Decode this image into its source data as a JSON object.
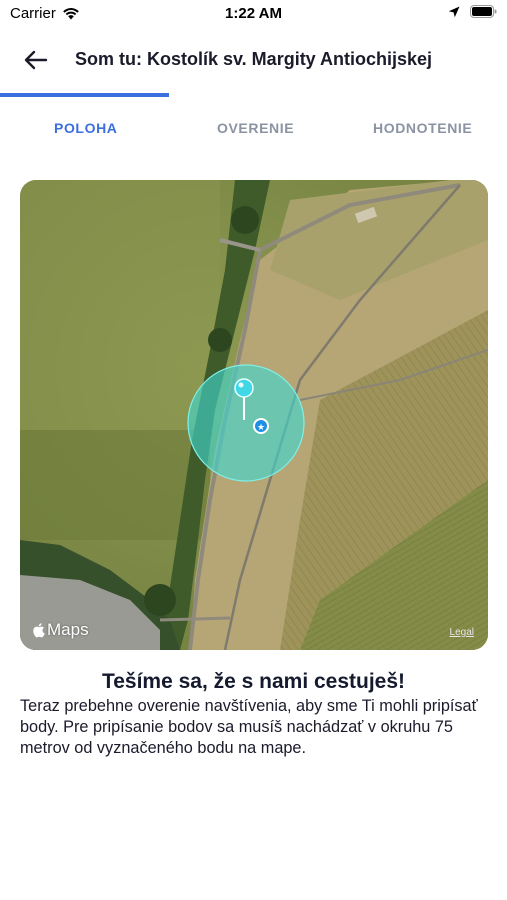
{
  "status_bar": {
    "carrier": "Carrier",
    "time": "1:22 AM"
  },
  "header": {
    "title": "Som tu: Kostolík sv. Margity Antiochijskej"
  },
  "progress": {
    "fraction": 0.333
  },
  "tabs": [
    {
      "label": "POLOHA",
      "active": true
    },
    {
      "label": "OVERENIE",
      "active": false
    },
    {
      "label": "HODNOTENIE",
      "active": false
    }
  ],
  "map": {
    "attribution": "Maps",
    "legal": "Legal",
    "radius_m": 75
  },
  "content": {
    "headline": "Tešíme sa, že s nami cestuješ!",
    "body": "Teraz prebehne overenie navštívenia, aby sme Ti mohli pripísať body. Pre pripísanie bodov sa musíš nachádzať v okruhu 75 metrov od vyznačeného bodu na mape."
  },
  "colors": {
    "accent": "#3b6fe0",
    "inactive_tab": "#8b93a3",
    "circle": "#3fd8d0"
  }
}
